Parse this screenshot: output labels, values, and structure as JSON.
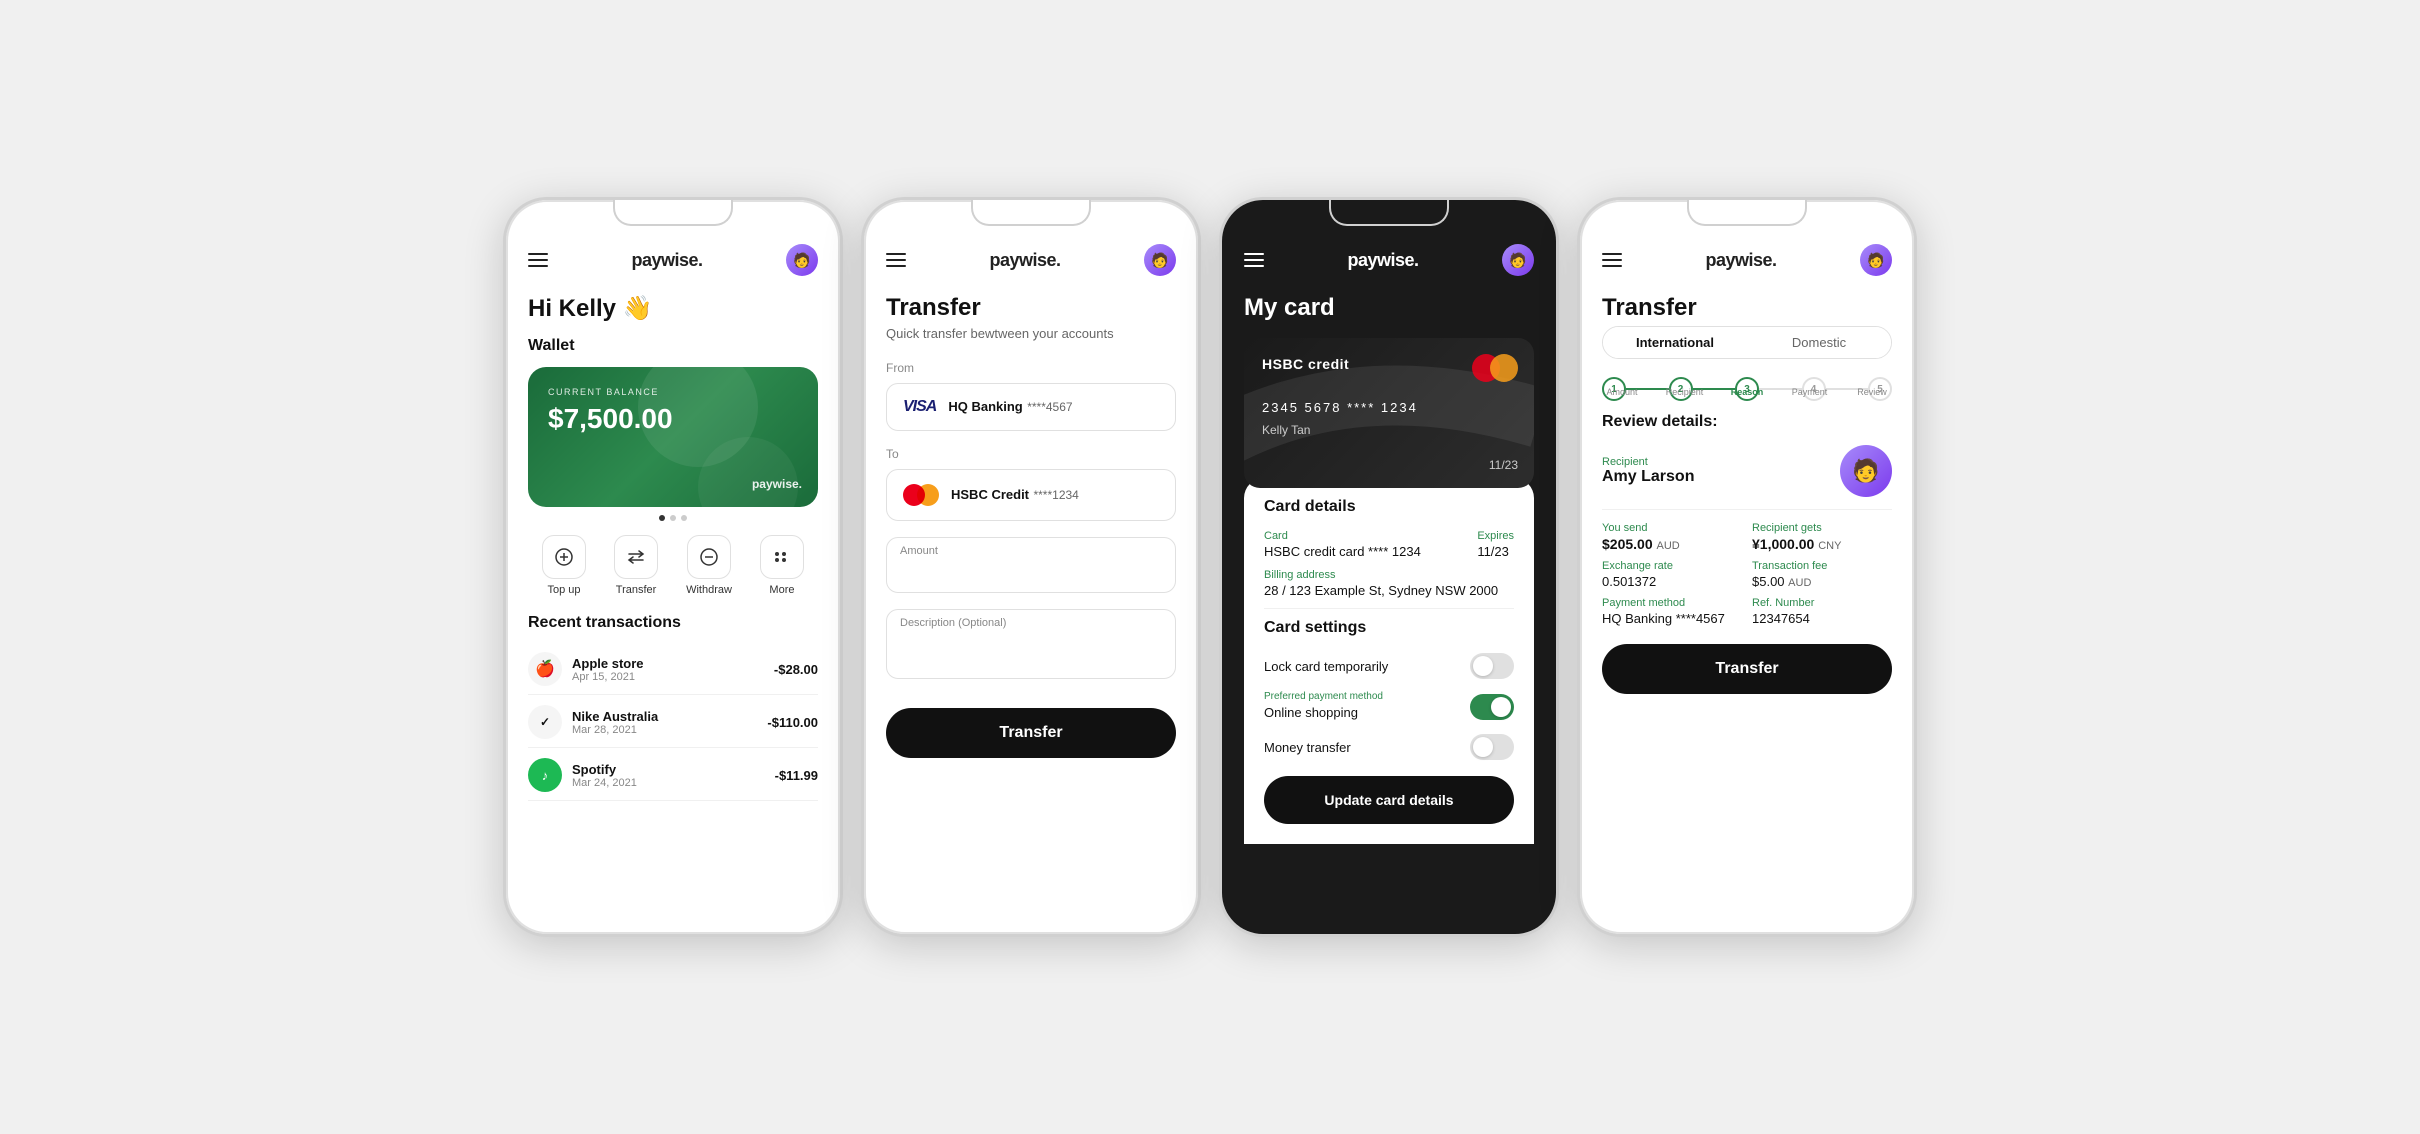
{
  "app": {
    "name": "paywise.",
    "avatar_emoji": "👤"
  },
  "screen1": {
    "greeting": "Hi Kelly 👋",
    "wallet_section": "Wallet",
    "wallet": {
      "label": "CURRENT BALANCE",
      "balance": "$7,500.00",
      "brand": "paywise."
    },
    "actions": [
      {
        "icon": "⊕",
        "label": "Top up"
      },
      {
        "icon": "⇄",
        "label": "Transfer"
      },
      {
        "icon": "⊖",
        "label": "Withdraw"
      },
      {
        "icon": "⠿",
        "label": "More"
      }
    ],
    "recent_title": "Recent transactions",
    "transactions": [
      {
        "icon": "🍎",
        "name": "Apple store",
        "date": "Apr 15, 2021",
        "amount": "-$28.00"
      },
      {
        "icon": "✔",
        "name": "Nike Australia",
        "date": "Mar 28, 2021",
        "amount": "-$110.00"
      },
      {
        "icon": "🎵",
        "name": "Spotify",
        "date": "Mar 24, 2021",
        "amount": "-$11.99"
      }
    ]
  },
  "screen2": {
    "title": "Transfer",
    "subtitle": "Quick transfer bewtween your accounts",
    "from_label": "From",
    "to_label": "To",
    "from": {
      "type": "visa",
      "name": "HQ Banking",
      "number": "****4567"
    },
    "to": {
      "type": "mastercard",
      "name": "HSBC Credit",
      "number": "****1234"
    },
    "amount_label": "Amount",
    "description_label": "Description (Optional)",
    "btn_label": "Transfer"
  },
  "screen3": {
    "title": "My card",
    "card": {
      "bank": "HSBC credit",
      "number": "2345 5678 **** 1234",
      "holder": "Kelly Tan",
      "expiry": "11/23"
    },
    "details": {
      "title": "Card details",
      "card_label": "Card",
      "card_val": "HSBC credit card **** 1234",
      "expires_label": "Expires",
      "expires_val": "11/23",
      "billing_label": "Billing address",
      "billing_val": "28 / 123 Example St, Sydney NSW 2000"
    },
    "settings": {
      "title": "Card settings",
      "items": [
        {
          "label": "Lock card temporarily",
          "on": false,
          "preferred": false
        },
        {
          "label": "Online shopping",
          "on": true,
          "preferred": true,
          "preferred_label": "Preferred payment method"
        },
        {
          "label": "Money transfer",
          "on": false,
          "preferred": false
        }
      ]
    },
    "update_btn": "Update card details"
  },
  "screen4": {
    "title": "Transfer",
    "tabs": [
      "International",
      "Domestic"
    ],
    "active_tab": 0,
    "steps": [
      {
        "num": "1",
        "label": "Amount",
        "state": "done"
      },
      {
        "num": "2",
        "label": "Recipient",
        "state": "done"
      },
      {
        "num": "3",
        "label": "Reason",
        "state": "active"
      },
      {
        "num": "4",
        "label": "Payment",
        "state": "default"
      },
      {
        "num": "5",
        "label": "Review",
        "state": "default"
      }
    ],
    "review_title": "Review details:",
    "recipient": {
      "label": "Recipient",
      "name": "Amy Larson"
    },
    "you_send_label": "You send",
    "you_send_val": "$205.00",
    "you_send_currency": "AUD",
    "recipient_gets_label": "Recipient gets",
    "recipient_gets_val": "¥1,000.00",
    "recipient_gets_currency": "CNY",
    "exchange_rate_label": "Exchange rate",
    "exchange_rate_val": "0.501372",
    "tx_fee_label": "Transaction fee",
    "tx_fee_val": "$5.00",
    "tx_fee_currency": "AUD",
    "payment_method_label": "Payment method",
    "payment_method_val": "HQ Banking ****4567",
    "ref_label": "Ref. Number",
    "ref_val": "12347654",
    "btn_label": "Transfer"
  }
}
